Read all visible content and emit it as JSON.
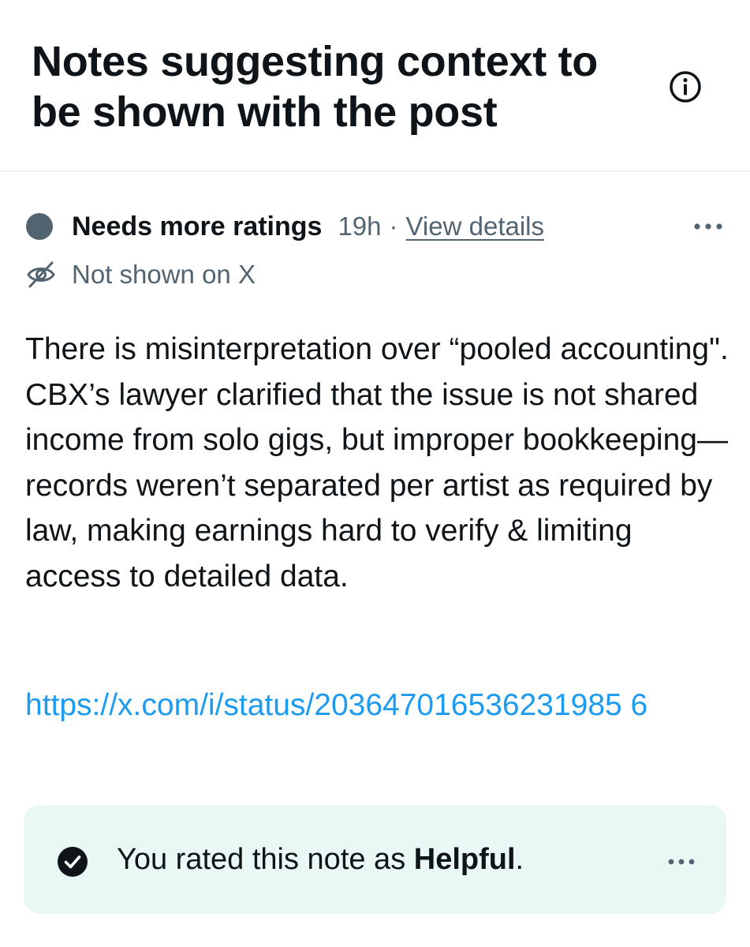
{
  "header": {
    "title": "Notes suggesting context to be shown with the post",
    "info_icon": "info-circle-icon"
  },
  "status": {
    "dot_color": "#536471",
    "label": "Needs more ratings",
    "time": "19h",
    "separator": "·",
    "view_details": "View details",
    "more_icon": "more-horizontal-icon"
  },
  "visibility": {
    "icon": "eye-off-icon",
    "text": "Not shown on X"
  },
  "note": {
    "body": "There is misinterpretation over “pooled accounting\". CBX’s lawyer clarified that the issue is not shared income from solo gigs, but improper bookkeeping—records weren’t separated per artist as required by law, making earnings hard to verify & limiting access to detailed data.",
    "link": "https://x.com/i/status/203647016536231985 6"
  },
  "rating": {
    "icon": "check-circle-icon",
    "prefix": "You rated this note as ",
    "value": "Helpful",
    "suffix": ".",
    "background": "#eaf8f5",
    "more_icon": "more-horizontal-icon"
  },
  "colors": {
    "text_primary": "#0f1419",
    "text_secondary": "#536471",
    "link": "#1d9bf0"
  }
}
